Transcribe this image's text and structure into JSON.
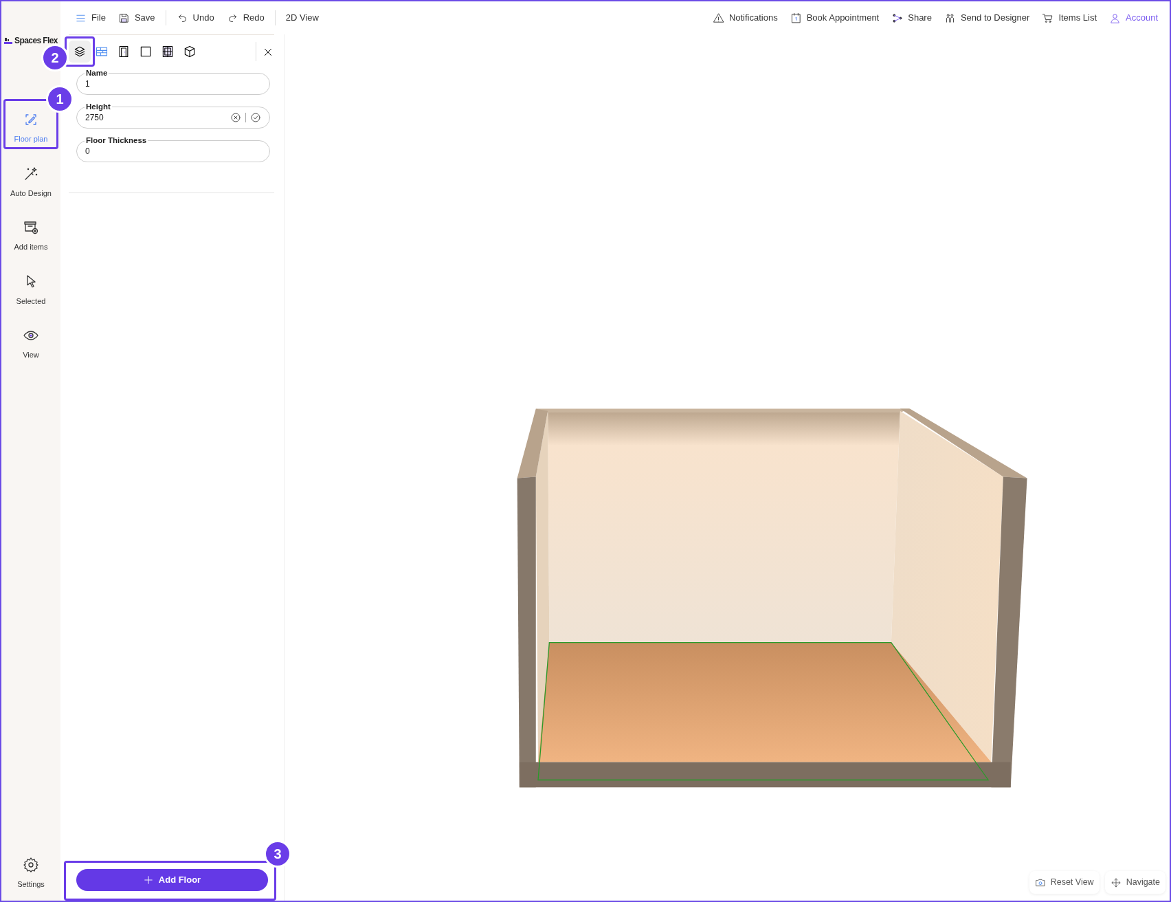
{
  "sidebar": {
    "logo": "Spaces Flex",
    "items": [
      {
        "label": "Floor plan",
        "selected": true,
        "annotation": "1"
      },
      {
        "label": "Auto Design",
        "selected": false
      },
      {
        "label": "Add items",
        "selected": false
      },
      {
        "label": "Selected",
        "selected": false
      },
      {
        "label": "View",
        "selected": false
      }
    ],
    "footer": {
      "label": "Settings"
    }
  },
  "toolbar": {
    "groups": [
      [
        {
          "label": "File"
        },
        {
          "label": "Save"
        }
      ],
      [
        {
          "label": "Undo"
        },
        {
          "label": "Redo"
        }
      ],
      [
        {
          "label": "2D View"
        }
      ]
    ],
    "right": [
      {
        "label": "Notifications",
        "highlighted": false
      },
      {
        "label": "Book Appointment",
        "highlighted": false
      },
      {
        "label": "Share",
        "highlighted": false
      },
      {
        "label": "Send to Designer",
        "highlighted": false
      },
      {
        "label": "Items List",
        "highlighted": false
      },
      {
        "label": "Account",
        "highlighted": true
      }
    ]
  },
  "panel": {
    "tabs": [
      {
        "selected": true,
        "annotation": "2"
      },
      {
        "selected": false
      },
      {
        "selected": false
      },
      {
        "selected": false
      },
      {
        "selected": false
      },
      {
        "selected": false
      }
    ],
    "fields": [
      {
        "label": "Name",
        "value": "1",
        "actions": false
      },
      {
        "label": "Height",
        "value": "2750",
        "actions": true
      },
      {
        "label": "Floor Thickness",
        "value": "0",
        "actions": false
      }
    ],
    "add_button": {
      "label": "Add Floor",
      "annotation": "3"
    }
  },
  "viewport": {
    "buttons": [
      {
        "label": "Reset View"
      },
      {
        "label": "Navigate"
      }
    ]
  }
}
